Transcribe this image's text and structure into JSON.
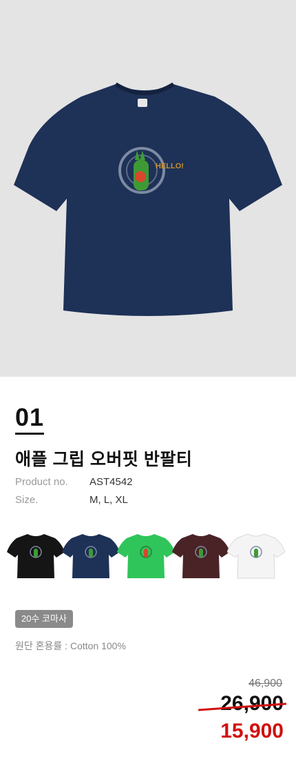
{
  "product": {
    "number": "01",
    "name": "애플 그립 오버핏 반팔티",
    "specs": [
      {
        "label": "Product no.",
        "value": "AST4542"
      },
      {
        "label": "Size.",
        "value": "M, L, XL"
      }
    ],
    "graphic_text": "HELLO!",
    "colors": [
      {
        "name": "black",
        "hex": "#151515"
      },
      {
        "name": "navy",
        "hex": "#1e3157"
      },
      {
        "name": "green",
        "hex": "#2fc55a"
      },
      {
        "name": "brown",
        "hex": "#4a2326"
      },
      {
        "name": "white",
        "hex": "#f4f4f4"
      }
    ],
    "badge": "20수 코마사",
    "fabric": "원단 혼용률 : Cotton 100%",
    "price": {
      "original": "46,900",
      "previous": "26,900",
      "sale": "15,900"
    }
  },
  "theme": {
    "hero_bg": "#e4e4e4",
    "tee_color": "#1e3157",
    "accent": "#d10f0f"
  }
}
